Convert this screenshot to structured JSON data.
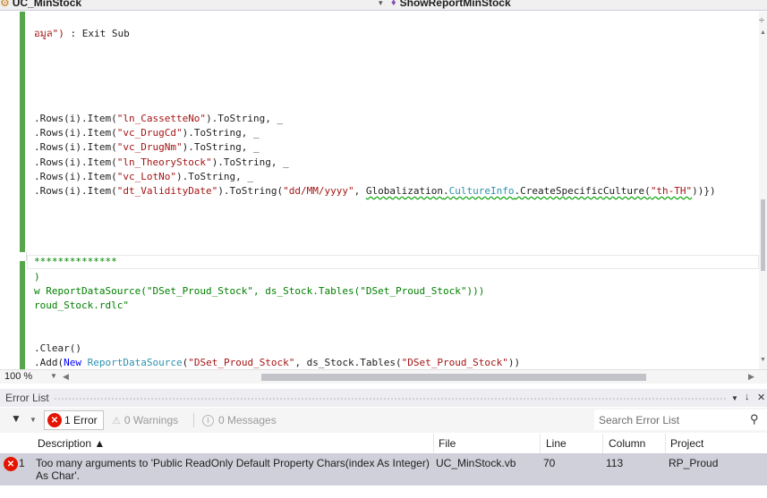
{
  "nav": {
    "class_name": "UC_MinStock",
    "method_name": "ShowReportMinStock"
  },
  "code": {
    "lines": [
      {
        "parts": [
          {
            "t": "อมูล\") ",
            "c": "s"
          },
          {
            "t": ": Exit Sub",
            "c": ""
          }
        ]
      },
      {
        "parts": [
          {
            "t": ".Rows(i).Item(",
            "c": ""
          },
          {
            "t": "\"ln_CassetteNo\"",
            "c": "s"
          },
          {
            "t": ").ToString, _",
            "c": ""
          }
        ]
      },
      {
        "parts": [
          {
            "t": ".Rows(i).Item(",
            "c": ""
          },
          {
            "t": "\"vc_DrugCd\"",
            "c": "s"
          },
          {
            "t": ").ToString, _",
            "c": ""
          }
        ]
      },
      {
        "parts": [
          {
            "t": ".Rows(i).Item(",
            "c": ""
          },
          {
            "t": "\"vc_DrugNm\"",
            "c": "s"
          },
          {
            "t": ").ToString, _",
            "c": ""
          }
        ]
      },
      {
        "parts": [
          {
            "t": ".Rows(i).Item(",
            "c": ""
          },
          {
            "t": "\"ln_TheoryStock\"",
            "c": "s"
          },
          {
            "t": ").ToString, _",
            "c": ""
          }
        ]
      },
      {
        "parts": [
          {
            "t": ".Rows(i).Item(",
            "c": ""
          },
          {
            "t": "\"vc_LotNo\"",
            "c": "s"
          },
          {
            "t": ").ToString, _",
            "c": ""
          }
        ]
      },
      {
        "parts": [
          {
            "t": ".Rows(i).Item(",
            "c": ""
          },
          {
            "t": "\"dt_ValidityDate\"",
            "c": "s"
          },
          {
            "t": ").ToString(",
            "c": ""
          },
          {
            "t": "\"dd/MM/yyyy\"",
            "c": "s"
          },
          {
            "t": ", ",
            "c": ""
          },
          {
            "t": "Globalization",
            "c": "u"
          },
          {
            "t": ".",
            "c": "u"
          },
          {
            "t": "CultureInfo",
            "c": "t u"
          },
          {
            "t": ".CreateSpecificCulture(",
            "c": "u"
          },
          {
            "t": "\"th-TH\"",
            "c": "s u"
          },
          {
            "t": "))})",
            "c": ""
          }
        ]
      },
      {
        "parts": [
          {
            "t": "**************",
            "c": "c"
          }
        ]
      },
      {
        "parts": [
          {
            "t": ")",
            "c": "c"
          }
        ]
      },
      {
        "parts": [
          {
            "t": "w ReportDataSource(\"DSet_Proud_Stock\", ds_Stock.Tables(\"DSet_Proud_Stock\")))",
            "c": "c"
          }
        ]
      },
      {
        "parts": [
          {
            "t": "roud_Stock.rdlc\"",
            "c": "c"
          }
        ]
      },
      {
        "parts": [
          {
            "t": ".Clear()",
            "c": ""
          }
        ]
      },
      {
        "parts": [
          {
            "t": ".Add(",
            "c": ""
          },
          {
            "t": "New",
            "c": "k"
          },
          {
            "t": " ",
            "c": ""
          },
          {
            "t": "ReportDataSource",
            "c": "t"
          },
          {
            "t": "(",
            "c": ""
          },
          {
            "t": "\"DSet_Proud_Stock\"",
            "c": "s"
          },
          {
            "t": ", ds_Stock.Tables(",
            "c": ""
          },
          {
            "t": "\"DSet_Proud_Stock\"",
            "c": "s"
          },
          {
            "t": "))",
            "c": ""
          }
        ]
      }
    ]
  },
  "editor": {
    "zoom": "100 %"
  },
  "error_list": {
    "title": "Error List",
    "errors_label": "1 Error",
    "warnings_label": "0 Warnings",
    "messages_label": "0 Messages",
    "search_placeholder": "Search Error List",
    "columns": {
      "description": "Description",
      "file": "File",
      "line": "Line",
      "column": "Column",
      "project": "Project"
    },
    "rows": [
      {
        "num": "1",
        "description": "Too many arguments to 'Public ReadOnly Default Property Chars(index As Integer) As Char'.",
        "file": "UC_MinStock.vb",
        "line": "70",
        "column": "113",
        "project": "RP_Proud"
      }
    ]
  }
}
